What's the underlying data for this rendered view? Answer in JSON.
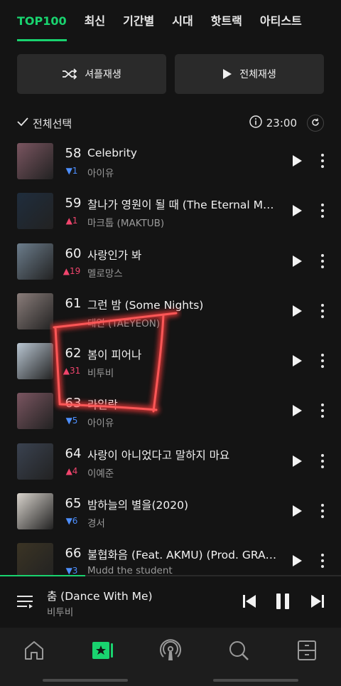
{
  "tabs": [
    {
      "label": "TOP100",
      "active": true
    },
    {
      "label": "최신",
      "active": false
    },
    {
      "label": "기간별",
      "active": false
    },
    {
      "label": "시대",
      "active": false
    },
    {
      "label": "핫트랙",
      "active": false
    },
    {
      "label": "아티스트",
      "active": false
    }
  ],
  "controls": {
    "shuffle_label": "셔플재생",
    "play_all_label": "전체재생",
    "select_all_label": "전체선택",
    "update_time": "23:00"
  },
  "songs": [
    {
      "rank": "58",
      "change": "1",
      "direction": "down",
      "title": "Celebrity",
      "artist": "아이유",
      "art": "#7a5560"
    },
    {
      "rank": "59",
      "change": "1",
      "direction": "up",
      "title": "찰나가 영원이 될 때 (The Eternal M…",
      "artist": "마크툽 (MAKTUB)",
      "art": "#1f2d3d"
    },
    {
      "rank": "60",
      "change": "19",
      "direction": "up",
      "title": "사랑인가 봐",
      "artist": "멜로망스",
      "art": "#6c7d8c"
    },
    {
      "rank": "61",
      "change": "",
      "direction": "",
      "title": "그런 밤 (Some Nights)",
      "artist": "태연 (TAEYEON)",
      "art": "#8a7d7a"
    },
    {
      "rank": "62",
      "change": "31",
      "direction": "up",
      "title": "봄이 피어나",
      "artist": "비투비",
      "art": "#b9c6d2"
    },
    {
      "rank": "63",
      "change": "5",
      "direction": "down",
      "title": "라일락",
      "artist": "아이유",
      "art": "#7a5560"
    },
    {
      "rank": "64",
      "change": "4",
      "direction": "up",
      "title": "사랑이 아니었다고 말하지 마요",
      "artist": "이예준",
      "art": "#3a4250"
    },
    {
      "rank": "65",
      "change": "6",
      "direction": "down",
      "title": "밤하늘의 별을(2020)",
      "artist": "경서",
      "art": "#d8d3cc"
    },
    {
      "rank": "66",
      "change": "3",
      "direction": "down",
      "title": "불협화음 (Feat. AKMU) (Prod. GRA…",
      "artist": "Mudd the student",
      "art": "#3b3424"
    }
  ],
  "now_playing": {
    "title": "춤 (Dance With Me)",
    "artist": "비투비",
    "progress": 0.25
  },
  "bottom_nav": [
    {
      "icon": "home-icon",
      "active": false
    },
    {
      "icon": "chart-icon",
      "active": true
    },
    {
      "icon": "podcast-icon",
      "active": false
    },
    {
      "icon": "search-icon",
      "active": false
    },
    {
      "icon": "library-icon",
      "active": false
    }
  ],
  "colors": {
    "accent": "#19d36f",
    "rank_up": "#f0456d",
    "rank_down": "#4d8fff",
    "background": "#141414",
    "annotation": "#ff4a4a"
  }
}
